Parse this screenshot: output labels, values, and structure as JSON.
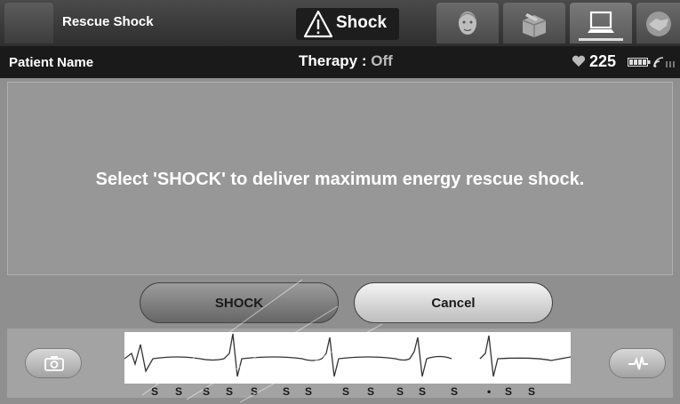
{
  "header": {
    "screen_title": "Rescue Shock",
    "shock_indicator": "Shock",
    "nav_tabs": [
      {
        "icon": "patient-face-icon",
        "active": false
      },
      {
        "icon": "box-tools-icon",
        "active": false
      },
      {
        "icon": "laptop-icon",
        "active": true
      },
      {
        "icon": "handshake-icon",
        "active": false
      }
    ]
  },
  "status": {
    "patient_name": "Patient Name",
    "therapy_label": "Therapy :",
    "therapy_value": "Off",
    "heart_rate": "225"
  },
  "message": "Select 'SHOCK' to deliver maximum energy rescue shock.",
  "buttons": {
    "shock": "SHOCK",
    "cancel": "Cancel"
  },
  "ecg": {
    "marks": [
      "S",
      "S",
      "S",
      "S",
      "S",
      "S",
      "S",
      "S",
      "S",
      "S",
      "S",
      "S",
      "•",
      "S",
      "S"
    ],
    "left_button_icon": "camera-icon",
    "right_button_icon": "ecg-wave-icon"
  },
  "colors": {
    "topbar": "#3a3a3a",
    "statusbar": "#1a1a1a",
    "panel": "#979797",
    "therapy_off": "#bcbcbc"
  }
}
